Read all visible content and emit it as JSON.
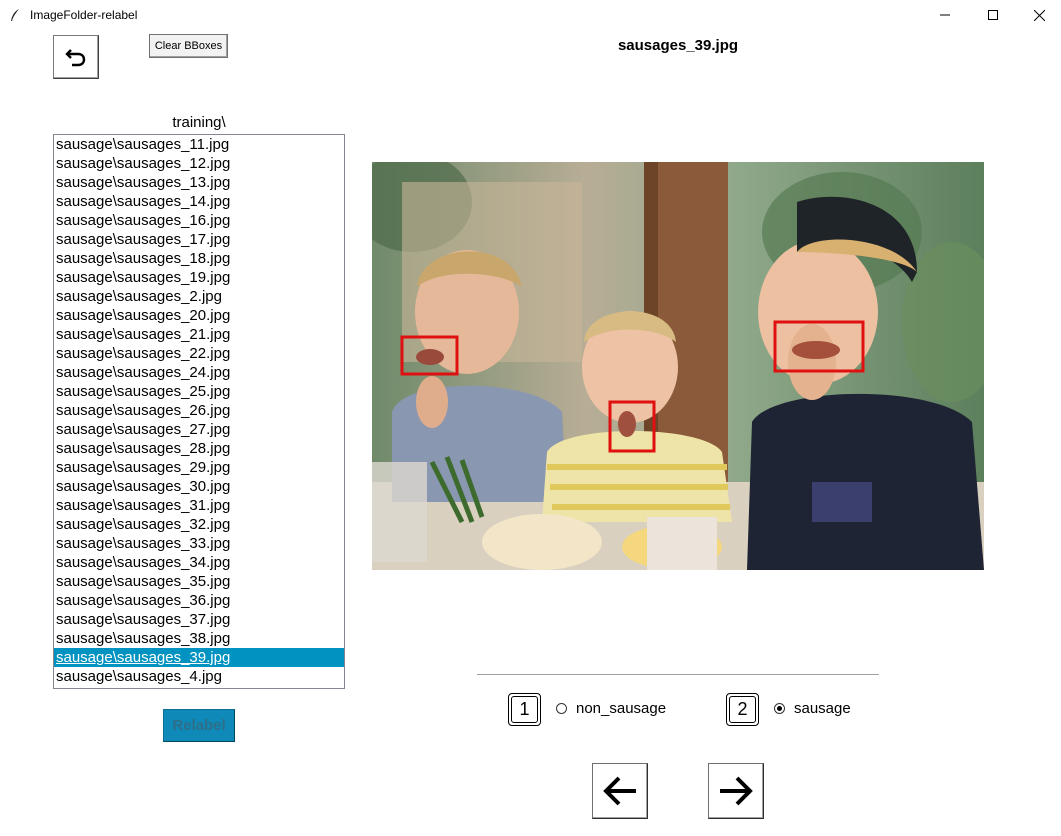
{
  "window": {
    "title": "ImageFolder-relabel",
    "icons": [
      "feather-icon",
      "minimize-icon",
      "maximize-icon",
      "close-icon"
    ]
  },
  "toolbar": {
    "undo_icon": "undo-icon",
    "clear_label": "Clear BBoxes"
  },
  "current_file": "sausages_39.jpg",
  "folder_label": "training\\",
  "file_list": [
    "sausage\\sausages_11.jpg",
    "sausage\\sausages_12.jpg",
    "sausage\\sausages_13.jpg",
    "sausage\\sausages_14.jpg",
    "sausage\\sausages_16.jpg",
    "sausage\\sausages_17.jpg",
    "sausage\\sausages_18.jpg",
    "sausage\\sausages_19.jpg",
    "sausage\\sausages_2.jpg",
    "sausage\\sausages_20.jpg",
    "sausage\\sausages_21.jpg",
    "sausage\\sausages_22.jpg",
    "sausage\\sausages_24.jpg",
    "sausage\\sausages_25.jpg",
    "sausage\\sausages_26.jpg",
    "sausage\\sausages_27.jpg",
    "sausage\\sausages_28.jpg",
    "sausage\\sausages_29.jpg",
    "sausage\\sausages_30.jpg",
    "sausage\\sausages_31.jpg",
    "sausage\\sausages_32.jpg",
    "sausage\\sausages_33.jpg",
    "sausage\\sausages_34.jpg",
    "sausage\\sausages_35.jpg",
    "sausage\\sausages_36.jpg",
    "sausage\\sausages_37.jpg",
    "sausage\\sausages_38.jpg",
    "sausage\\sausages_39.jpg",
    "sausage\\sausages_4.jpg"
  ],
  "selected_index": 27,
  "relabel_label": "Relabel",
  "classes": [
    {
      "key": "1",
      "label": "non_sausage",
      "selected": false
    },
    {
      "key": "2",
      "label": "sausage",
      "selected": true
    }
  ],
  "navigation": {
    "prev_icon": "arrow-left-icon",
    "next_icon": "arrow-right-icon"
  },
  "colors": {
    "selection": "#0092c0",
    "relabel_button": "#0f8ab8",
    "bbox": "#e01010"
  }
}
